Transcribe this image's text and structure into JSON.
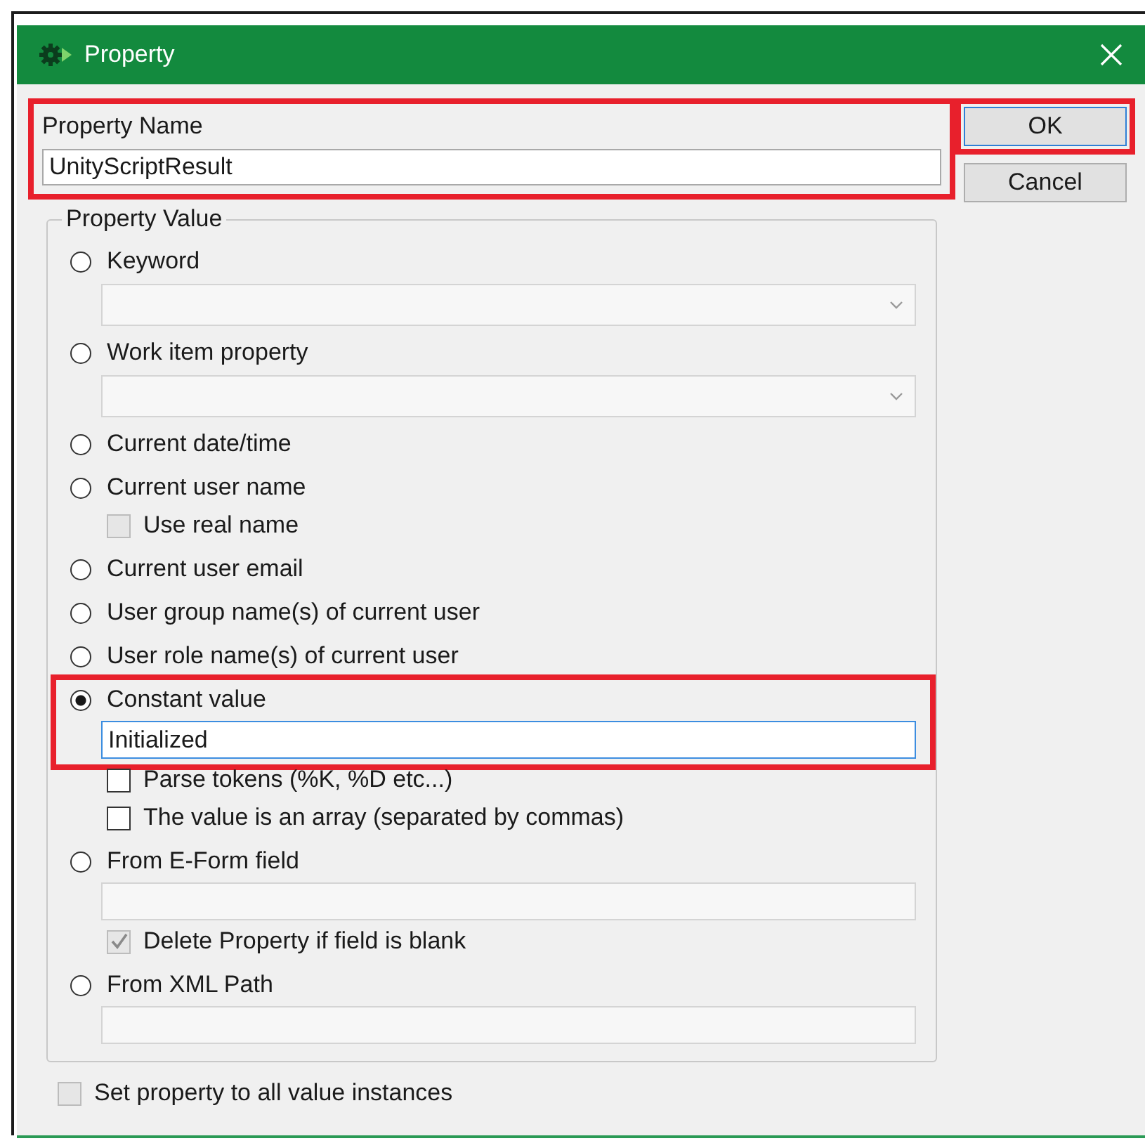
{
  "window": {
    "title": "Property"
  },
  "property_name": {
    "label": "Property Name",
    "value": "UnityScriptResult",
    "highlighted": true
  },
  "buttons": [
    {
      "label": "OK",
      "focused": true,
      "highlighted": true
    },
    {
      "label": "Cancel",
      "focused": false,
      "highlighted": false
    }
  ],
  "property_value": {
    "title": "Property Value",
    "options": [
      {
        "label": "Keyword",
        "selected": false,
        "highlighted": false,
        "sub": [
          {
            "kind": "dropdown",
            "disabled": true
          }
        ]
      },
      {
        "label": "Work item property",
        "selected": false,
        "highlighted": false,
        "sub": [
          {
            "kind": "dropdown",
            "disabled": true
          }
        ]
      },
      {
        "label": "Current date/time",
        "selected": false,
        "highlighted": false
      },
      {
        "label": "Current user name",
        "selected": false,
        "highlighted": false,
        "sub": [
          {
            "kind": "checkbox",
            "label": "Use real name",
            "checked": false,
            "disabled": true
          }
        ]
      },
      {
        "label": "Current user email",
        "selected": false,
        "highlighted": false
      },
      {
        "label": "User group name(s) of current user",
        "selected": false,
        "highlighted": false
      },
      {
        "label": "User role name(s) of current user",
        "selected": false,
        "highlighted": false
      },
      {
        "label": "Constant value",
        "selected": true,
        "highlighted": true,
        "sub": [
          {
            "kind": "field",
            "value": "Initialized",
            "disabled": false
          },
          {
            "kind": "checkbox",
            "label": "Parse tokens (%K, %D etc...)",
            "checked": false,
            "disabled": false
          },
          {
            "kind": "checkbox",
            "label": "The value is an array (separated by commas)",
            "checked": false,
            "disabled": false
          }
        ]
      },
      {
        "label": "From E-Form field",
        "selected": false,
        "highlighted": false,
        "sub": [
          {
            "kind": "field",
            "disabled": true
          },
          {
            "kind": "checkbox",
            "label": "Delete Property if field is blank",
            "checked": true,
            "disabled": true
          }
        ]
      },
      {
        "label": "From XML Path",
        "selected": false,
        "highlighted": false,
        "sub": [
          {
            "kind": "field",
            "disabled": true
          }
        ]
      }
    ]
  },
  "footer_option": {
    "label": "Set property to all value instances",
    "checked": false,
    "disabled": true
  }
}
